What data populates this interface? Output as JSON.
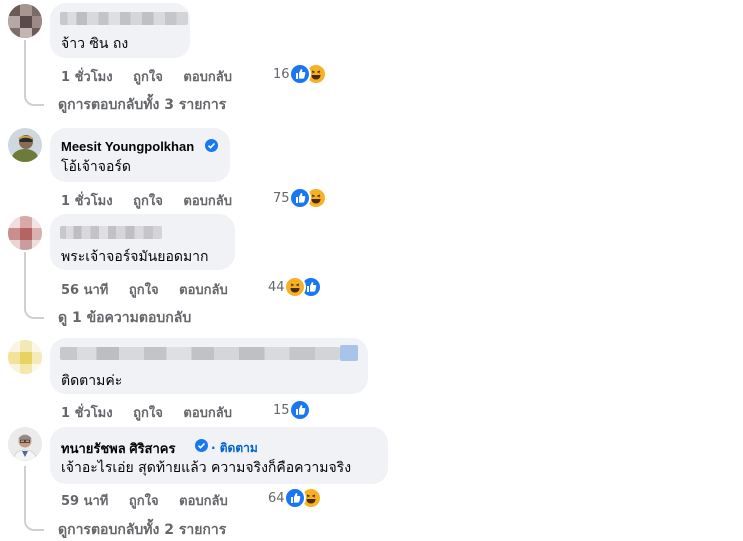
{
  "comments": [
    {
      "author": "",
      "text": "จ้าว ซิน ถง",
      "time": "1 ชั่วโมง",
      "like_label": "ถูกใจ",
      "reply_label": "ตอบกลับ",
      "reaction_count": "16",
      "reactions": [
        "like-icon",
        "haha-icon"
      ],
      "view_replies": "ดูการตอบกลับทั้ง 3 รายการ"
    },
    {
      "author": "Meesit Youngpolkhan",
      "verified": true,
      "text": "โอ้เจ้าจอร์ด",
      "time": "1 ชั่วโมง",
      "like_label": "ถูกใจ",
      "reply_label": "ตอบกลับ",
      "reaction_count": "75",
      "reactions": [
        "like-icon",
        "haha-icon"
      ]
    },
    {
      "author": "",
      "text": "พระเจ้าจอร์จมันยอดมาก",
      "time": "56 นาที",
      "like_label": "ถูกใจ",
      "reply_label": "ตอบกลับ",
      "reaction_count": "44",
      "reactions": [
        "haha-icon",
        "like-icon"
      ],
      "view_replies": "ดู 1 ข้อความตอบกลับ"
    },
    {
      "author": "",
      "text": "ติดตามค่ะ",
      "time": "1 ชั่วโมง",
      "like_label": "ถูกใจ",
      "reply_label": "ตอบกลับ",
      "reaction_count": "15",
      "reactions": [
        "like-icon"
      ]
    },
    {
      "author": "ทนายรัชพล ศิริสาคร",
      "verified": true,
      "follow_label": "· ติดตาม",
      "text": "เจ้าอะไรเอ่ย สุดท้ายแล้ว ความจริงก็คือความจริง",
      "time": "59 นาที",
      "like_label": "ถูกใจ",
      "reply_label": "ตอบกลับ",
      "reaction_count": "64",
      "reactions": [
        "like-icon",
        "haha-icon"
      ],
      "view_replies": "ดูการตอบกลับทั้ง 2 รายการ"
    }
  ],
  "colors": {
    "bubble": "#f0f2f5",
    "meta_text": "#65676b",
    "like_blue": "#1877f2",
    "haha_yellow": "#f7b125",
    "follow_link": "#0064d1",
    "thread_line": "#ced0d4"
  }
}
